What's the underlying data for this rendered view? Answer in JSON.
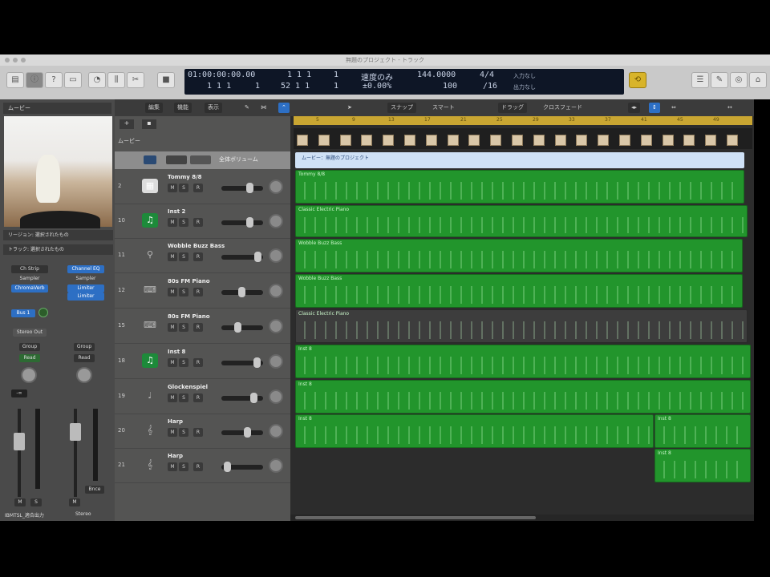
{
  "window": {
    "title": "無題のプロジェクト - トラック"
  },
  "lcd": {
    "timecode": "01:00:00:00.00",
    "bar_top": "1  1  1",
    "tick_top": "1",
    "bar_bottom": "1  1  1",
    "tick_bottom": "1",
    "pos2": "52  1  1",
    "tick2": "1",
    "mode": "速度のみ",
    "percent": "±0.00%",
    "tempo": "144.0000",
    "tempo_sub": "100",
    "signature": "4/4",
    "division": "/16",
    "in_label": "入力なし",
    "out_label": "出力なし"
  },
  "toolbar": {
    "stop_icon": "stop",
    "colors": {
      "cycle": "#d8b42a"
    }
  },
  "ctrlbar": {
    "edit": "編集",
    "function": "機能",
    "view": "表示",
    "snap_label": "スナップ",
    "snap_value": "スマート",
    "drag_label": "ドラッグ",
    "drag_value": "クロスフェード"
  },
  "inspector": {
    "section": "ムービー",
    "region_label": "リージョン: 選択されたもの",
    "track_label": "トラック: 選択されたもの",
    "ch1": {
      "eq": "Ch Strip",
      "inst": "Sampler",
      "fx": "ChromaVerb",
      "send": "Bus 1",
      "out": "Stereo Out",
      "group": "Group",
      "auto": "Read",
      "name": "IBMTSL_適合出力",
      "vol": "-∞",
      "mute": "M",
      "solo": "S"
    },
    "ch2": {
      "eq": "Channel EQ",
      "inst": "Sampler",
      "fx": "Limiter",
      "fx2": "Limiter",
      "group": "Group",
      "auto": "Read",
      "name": "Stereo",
      "bnce": "Bnce",
      "mute": "M"
    }
  },
  "headers": {
    "movie_label": "ムービー",
    "global": {
      "label": "全体ボリューム"
    }
  },
  "tracks": [
    {
      "num": "2",
      "name": "Tommy 8/8",
      "icon": "drum",
      "color": "#ddd"
    },
    {
      "num": "10",
      "name": "Inst 2",
      "icon": "music-note",
      "color": "#1d8a3a"
    },
    {
      "num": "11",
      "name": "Wobble Buzz Bass",
      "icon": "synth"
    },
    {
      "num": "12",
      "name": "80s FM Piano",
      "icon": "keys"
    },
    {
      "num": "15",
      "name": "80s FM Piano",
      "icon": "keys"
    },
    {
      "num": "18",
      "name": "Inst 8",
      "icon": "music-note",
      "color": "#1d8a3a"
    },
    {
      "num": "19",
      "name": "Glockenspiel",
      "icon": "mallet"
    },
    {
      "num": "20",
      "name": "Harp",
      "icon": "harp"
    },
    {
      "num": "21",
      "name": "Harp",
      "icon": "harp"
    }
  ],
  "ruler": [
    "5",
    "9",
    "13",
    "17",
    "21",
    "25",
    "29",
    "33",
    "37",
    "41",
    "45",
    "49"
  ],
  "movie_region": "ムービー：無題のプロジェクト",
  "regions": [
    "Tommy 8/8",
    "Classic Electric Piano",
    "Wobble Buzz Bass",
    "Wobble Buzz Bass",
    "Classic Electric Piano",
    "Inst 8",
    "Inst 8",
    "Inst 8",
    "Inst 8",
    "Inst 8"
  ]
}
